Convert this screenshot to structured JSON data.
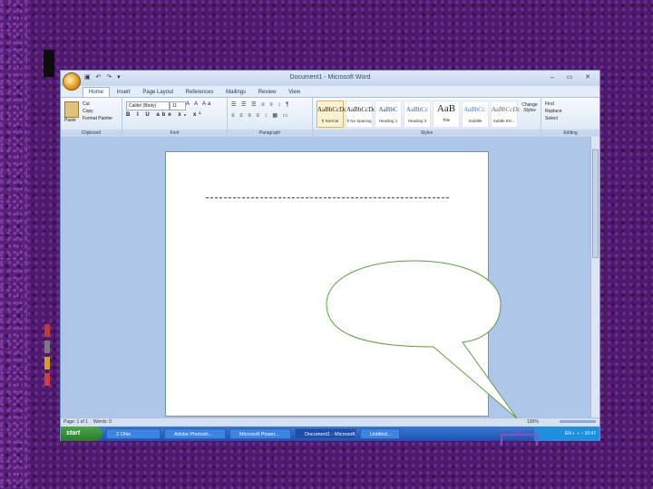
{
  "window": {
    "title": "Document1 - Microsoft Word",
    "quick_access": "▣ ↶ ↷ ▾",
    "controls": "– ▭ ✕"
  },
  "tabs": [
    "Home",
    "Insert",
    "Page Layout",
    "References",
    "Mailings",
    "Review",
    "View"
  ],
  "ribbon": {
    "clipboard": {
      "label": "Clipboard",
      "paste": "Paste",
      "cut": "Cut",
      "copy": "Copy",
      "format_painter": "Format Painter"
    },
    "font": {
      "label": "Font",
      "font_name": "Calibri (Body)",
      "font_size": "11",
      "format_buttons": "B I U abe x₂ x²",
      "extra": "A A Aa"
    },
    "paragraph": {
      "label": "Paragraph",
      "row1": "☰ ☰ ☰ ≡ ≡ ↕ ¶",
      "row2": "≡ ≡ ≡ ≡ ↕ ▦ ▭"
    },
    "styles": {
      "label": "Styles",
      "items": [
        {
          "sample": "AaBbCcDc",
          "name": "¶ Normal"
        },
        {
          "sample": "AaBbCcDc",
          "name": "¶ No Spacing"
        },
        {
          "sample": "AaBbC",
          "name": "Heading 1"
        },
        {
          "sample": "AaBbCc",
          "name": "Heading 2"
        },
        {
          "sample": "AaB",
          "name": "Title"
        },
        {
          "sample": "AaBbCc.",
          "name": "Subtitle"
        },
        {
          "sample": "AaBbCcDc",
          "name": "Subtle Em..."
        }
      ],
      "change": "Change Styles"
    },
    "editing": {
      "label": "Editing",
      "find": "Find",
      "replace": "Replace",
      "select": "Select"
    }
  },
  "status": {
    "page": "Page: 1 of 1",
    "words": "Words: 0",
    "zoom": "100%"
  },
  "taskbar": {
    "start": "start",
    "items": [
      {
        "label": "2 Ohio"
      },
      {
        "label": "Adobe Photosh..."
      },
      {
        "label": "Microsoft Power..."
      },
      {
        "label": "Document1 - Microsoft...",
        "active": true
      },
      {
        "label": "Untitled..."
      }
    ],
    "tray": "EN  ◐ ◑ ◔ 10:47"
  }
}
